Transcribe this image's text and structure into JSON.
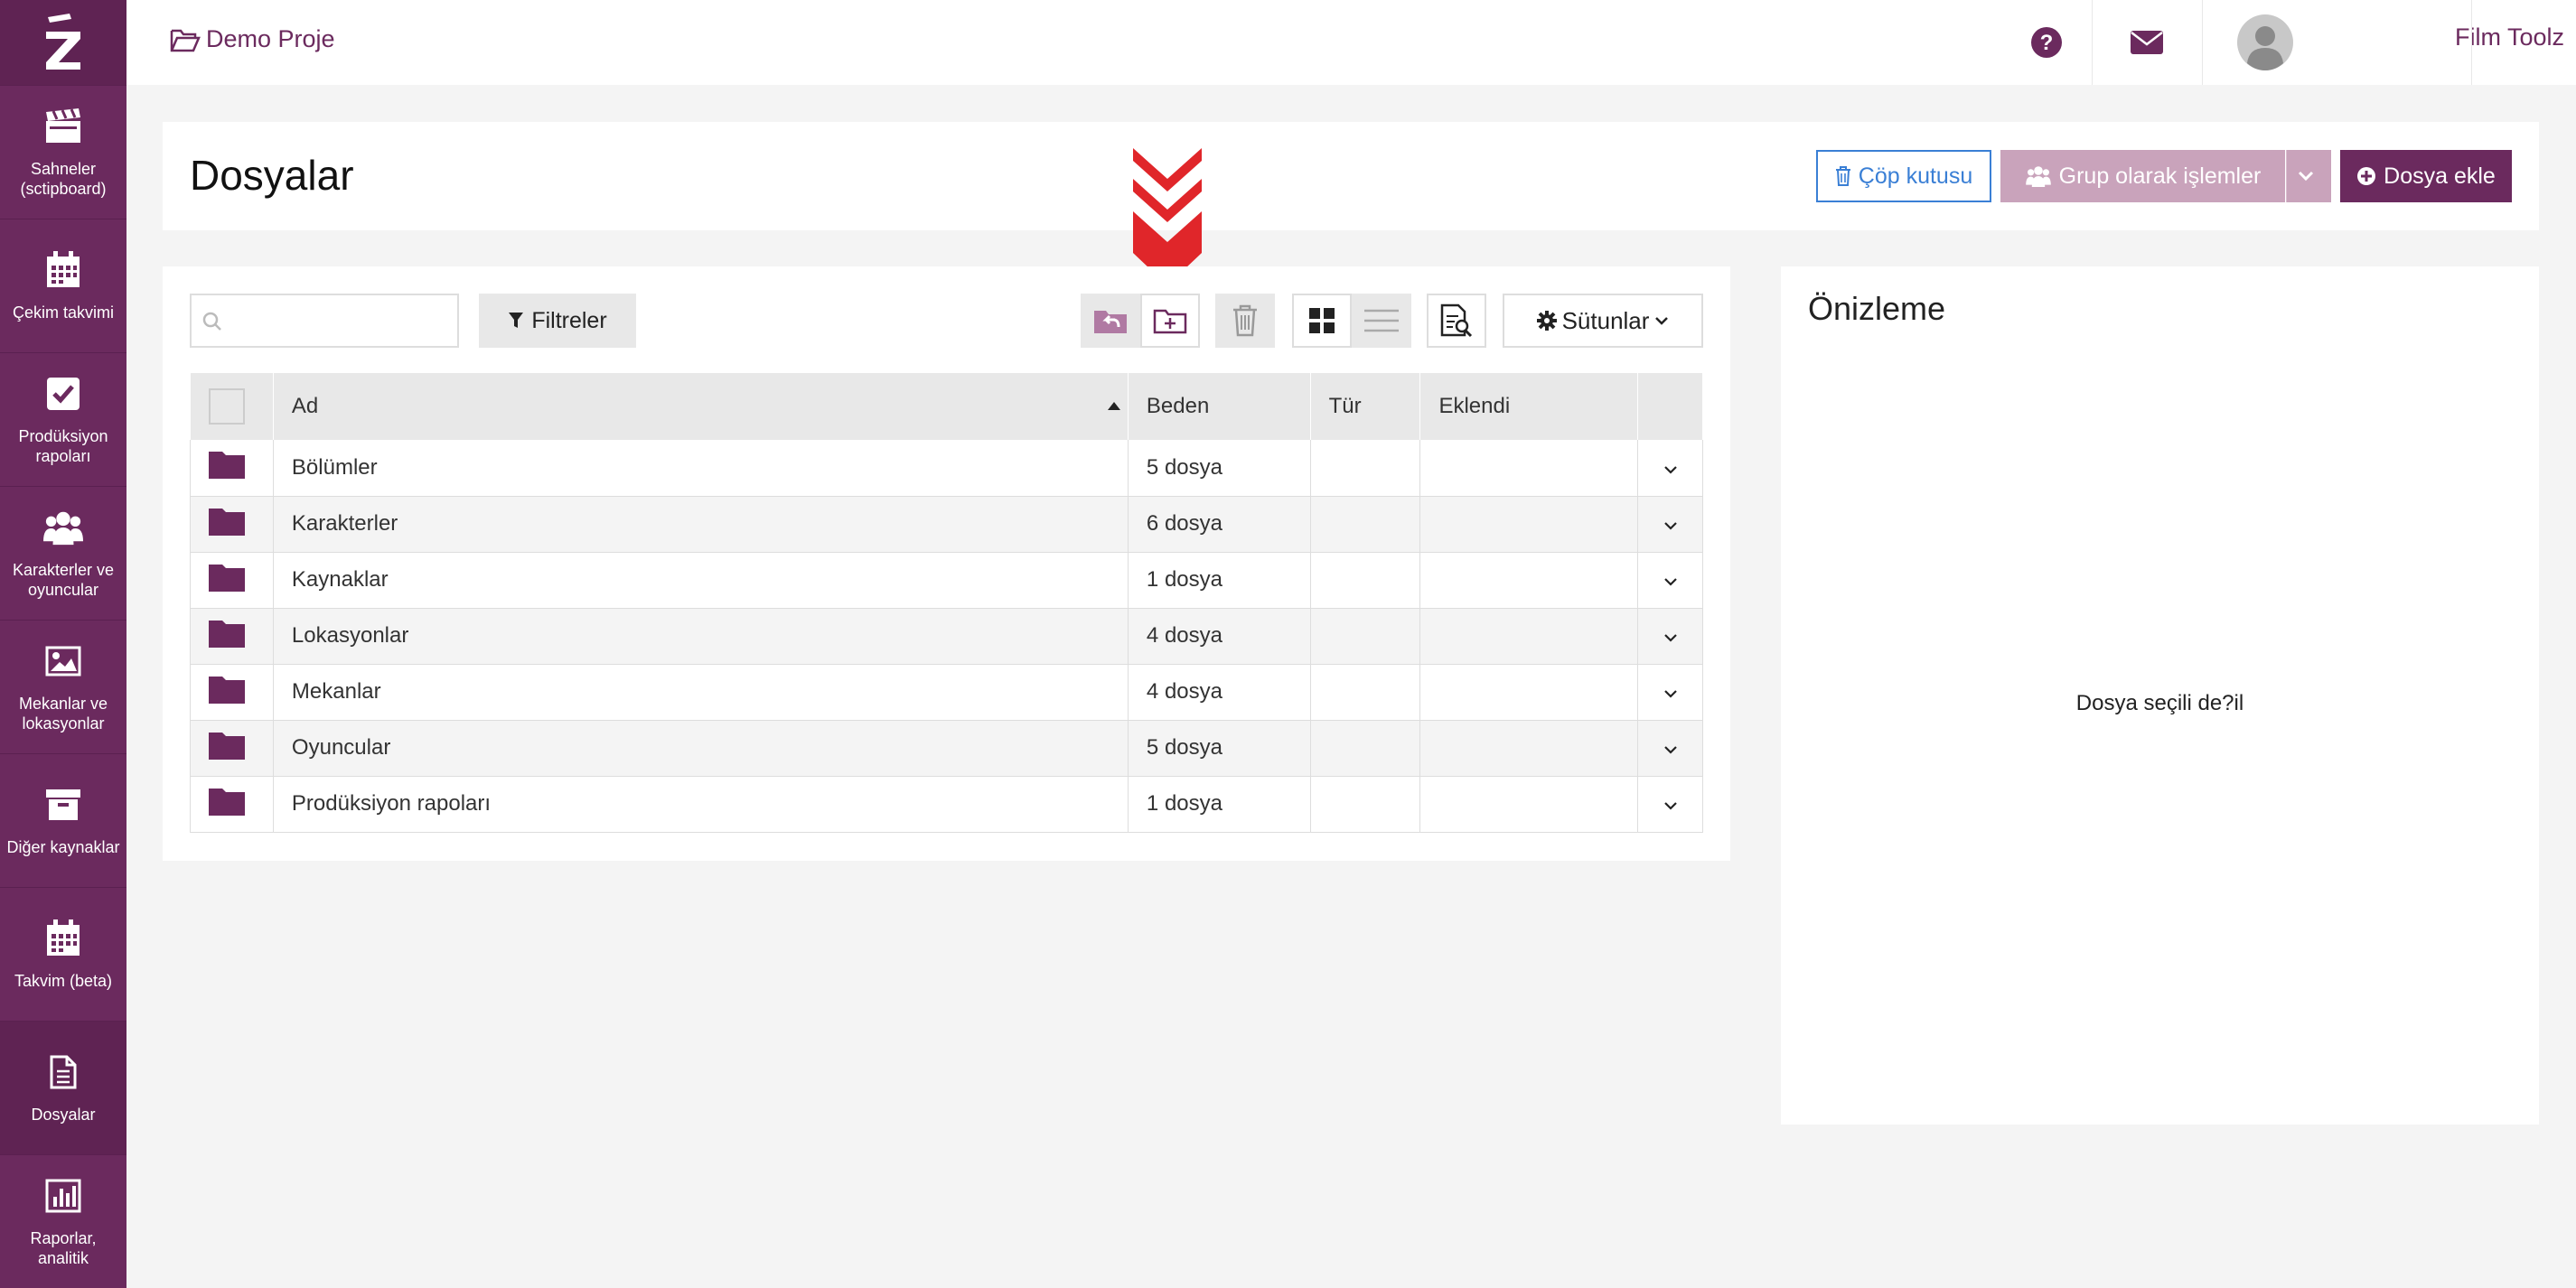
{
  "sidebar": {
    "items": [
      {
        "label": "Sahneler (sctipboard)",
        "icon": "clapperboard-icon"
      },
      {
        "label": "Çekim takvimi",
        "icon": "calendar-icon"
      },
      {
        "label": "Prodüksiyon rapoları",
        "icon": "checkbox-icon"
      },
      {
        "label": "Karakterler ve oyuncular",
        "icon": "users-icon"
      },
      {
        "label": "Mekanlar ve lokasyonlar",
        "icon": "image-icon"
      },
      {
        "label": "Diğer kaynaklar",
        "icon": "archive-icon"
      },
      {
        "label": "Takvim (beta)",
        "icon": "calendar-icon"
      },
      {
        "label": "Dosyalar",
        "icon": "file-icon",
        "active": true
      },
      {
        "label": "Raporlar, analitik",
        "icon": "bar-chart-icon"
      }
    ]
  },
  "header": {
    "project": "Demo Proje",
    "user_name": "Film Toolz",
    "language": "TR"
  },
  "page": {
    "title": "Dosyalar",
    "trash_label": "Çöp kutusu",
    "group_label": "Grup olarak işlemler",
    "add_label": "Dosya ekle"
  },
  "toolbar": {
    "search_placeholder": "",
    "filters_label": "Filtreler",
    "columns_label": "Sütunlar"
  },
  "table": {
    "headers": {
      "name": "Ad",
      "size": "Beden",
      "type": "Tür",
      "added": "Eklendi"
    },
    "rows": [
      {
        "name": "Bölümler",
        "size": "5 dosya",
        "type": "",
        "added": ""
      },
      {
        "name": "Karakterler",
        "size": "6 dosya",
        "type": "",
        "added": ""
      },
      {
        "name": "Kaynaklar",
        "size": "1 dosya",
        "type": "",
        "added": ""
      },
      {
        "name": "Lokasyonlar",
        "size": "4 dosya",
        "type": "",
        "added": ""
      },
      {
        "name": "Mekanlar",
        "size": "4 dosya",
        "type": "",
        "added": ""
      },
      {
        "name": "Oyuncular",
        "size": "5 dosya",
        "type": "",
        "added": ""
      },
      {
        "name": "Prodüksiyon rapoları",
        "size": "1 dosya",
        "type": "",
        "added": ""
      }
    ]
  },
  "preview": {
    "title": "Önizleme",
    "empty_text": "Dosya seçili de?il"
  },
  "colors": {
    "brand": "#6b2a5e",
    "group_button": "#c9a3bb",
    "trash_border": "#3a7fd5",
    "annotation": "#e0262a"
  }
}
